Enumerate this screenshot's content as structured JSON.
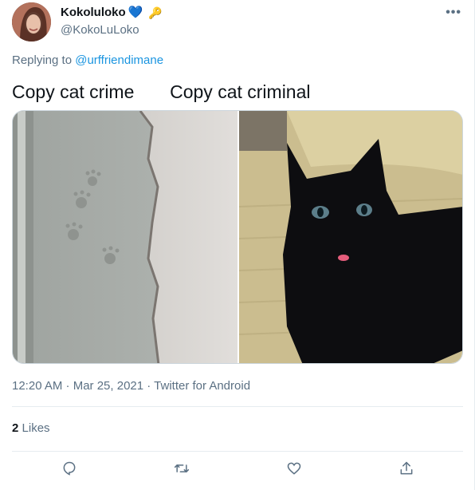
{
  "author": {
    "display_name": "Kokoluloko",
    "heart_glyph": "💙",
    "key_glyph": "🔑",
    "handle": "@KokoLuLoko"
  },
  "more_glyph": "•••",
  "reply": {
    "prefix": "Replying to",
    "mention": "@urffriendimane"
  },
  "tweet_text": "Copy cat crime       Copy cat criminal",
  "media": [
    {
      "icon": "photo-paw-prints-on-concrete"
    },
    {
      "icon": "photo-black-cat-tongue-out"
    }
  ],
  "timestamp": "12:20 AM · Mar 25, 2021 · Twitter for Android",
  "likes": {
    "count": "2",
    "label": "Likes"
  },
  "actions": [
    {
      "icon": "reply-icon"
    },
    {
      "icon": "retweet-icon"
    },
    {
      "icon": "like-icon"
    },
    {
      "icon": "share-icon"
    }
  ],
  "colors": {
    "link": "#1b95e0",
    "secondary_text": "#5b7083",
    "border": "#e6ecf0"
  }
}
